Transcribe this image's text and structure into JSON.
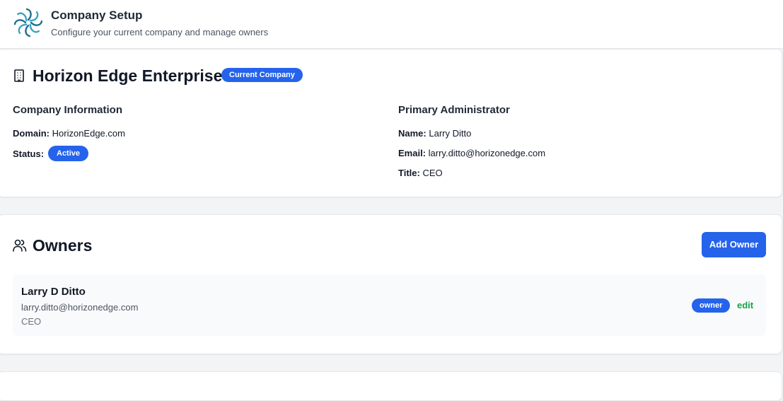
{
  "header": {
    "title": "Company Setup",
    "subtitle": "Configure your current company and manage owners",
    "logo_icon": "spiral-flower-logo"
  },
  "company": {
    "icon": "building-icon",
    "name": "Horizon Edge Enterprises",
    "badge": "Current Company",
    "info": {
      "heading": "Company Information",
      "domain_label": "Domain:",
      "domain_value": "HorizonEdge.com",
      "status_label": "Status:",
      "status_value": "Active"
    },
    "admin": {
      "heading": "Primary Administrator",
      "name_label": "Name:",
      "name_value": "Larry Ditto",
      "email_label": "Email:",
      "email_value": "larry.ditto@horizonedge.com",
      "title_label": "Title:",
      "title_value": "CEO"
    }
  },
  "owners": {
    "icon": "users-icon",
    "title": "Owners",
    "add_button": "Add Owner",
    "list": [
      {
        "name": "Larry D Ditto",
        "email": "larry.ditto@horizonedge.com",
        "title": "CEO",
        "role": "owner",
        "edit_label": "edit"
      }
    ]
  },
  "colors": {
    "accent": "#2563eb",
    "edit": "#16a34a",
    "background": "#f3f4f6"
  }
}
